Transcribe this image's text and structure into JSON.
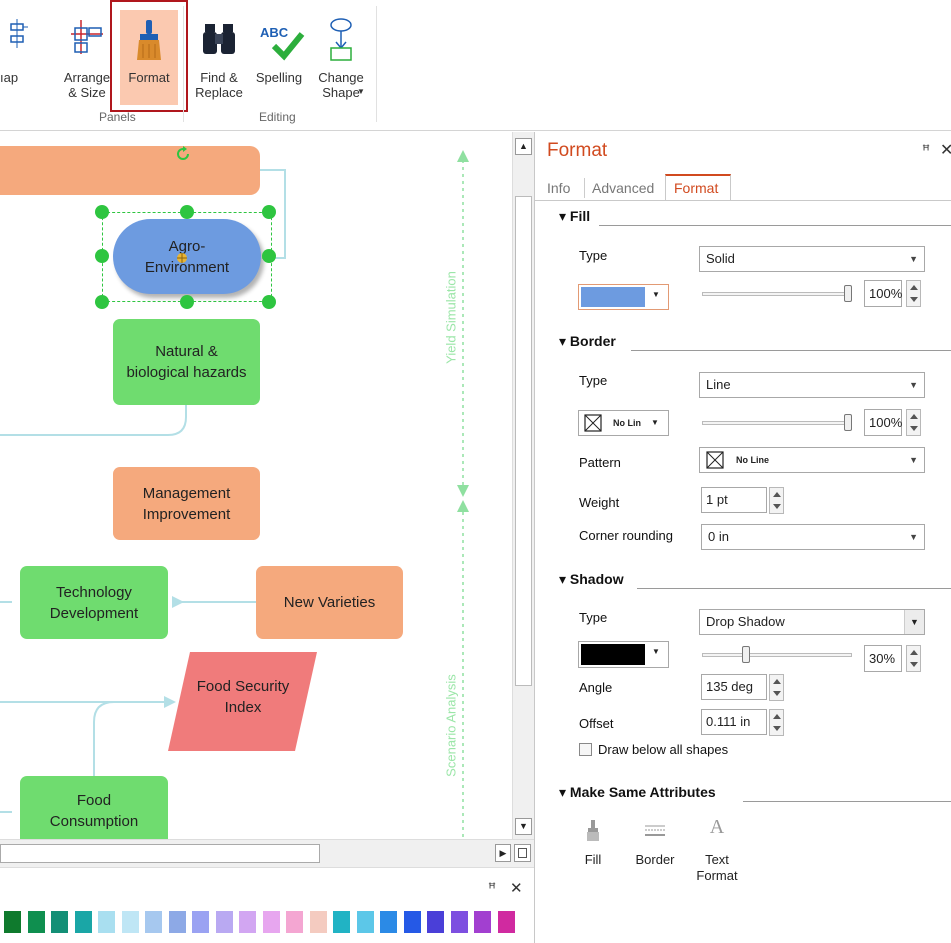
{
  "ribbon": {
    "map_label": "ıap",
    "arrange_label": "Arrange\n& Size",
    "format_label": "Format",
    "find_label": "Find &\nReplace",
    "spelling_label": "Spelling",
    "change_label": "Change\nShape",
    "abc_text": "ABC",
    "groups": {
      "panels": "Panels",
      "editing": "Editing"
    }
  },
  "diagram": {
    "nodes": {
      "agro": "Agro-\nEnvironment",
      "hazards": "Natural &\nbiological hazards",
      "management": "Management\nImprovement",
      "technology": "Technology\nDevelopment",
      "varieties": "New Varieties",
      "food_security": "Food Security\nIndex",
      "consumption": "Food\nConsumption"
    },
    "lane_labels": {
      "yield": "Yield Simulation",
      "scenario": "Scenario Analysis"
    }
  },
  "bottom_panel": {
    "pin": "ꟸ",
    "close": "✕"
  },
  "palette_colors": [
    "#0f7a2d",
    "#0f8f4f",
    "#138f76",
    "#1aa6a6",
    "#a9dff0",
    "#bfe6f5",
    "#a6c8ef",
    "#8da9e6",
    "#9aa2f2",
    "#b9a9f2",
    "#d2a6f2",
    "#e7a6ef",
    "#f4a6d2",
    "#f4cbc0",
    "#21b3c4",
    "#5cc7e8",
    "#2b8ae6",
    "#2559e6",
    "#4a3fd8",
    "#7d4fe0",
    "#a23fd0",
    "#d02aa0"
  ],
  "format_panel": {
    "title": "Format",
    "pin": "ꟸ",
    "close": "✕",
    "tabs": [
      "Info",
      "Advanced",
      "Format"
    ],
    "fill": {
      "header": "Fill",
      "type_label": "Type",
      "type_value": "Solid",
      "color": "#6d9be0",
      "opacity_value": "100%",
      "opacity_level": 1.0
    },
    "border": {
      "header": "Border",
      "type_label": "Type",
      "type_value": "Line",
      "line_swatch_label": "No Lin",
      "opacity_value": "100%",
      "opacity_level": 1.0,
      "pattern_label": "Pattern",
      "pattern_value": "No Line",
      "weight_label": "Weight",
      "weight_value": "1 pt",
      "corner_label": "Corner rounding",
      "corner_value": "0 in"
    },
    "shadow": {
      "header": "Shadow",
      "type_label": "Type",
      "type_value": "Drop Shadow",
      "color": "#000000",
      "opacity_value": "30%",
      "opacity_level": 0.3,
      "angle_label": "Angle",
      "angle_value": "135 deg",
      "offset_label": "Offset",
      "offset_value": "0.111 in",
      "draw_below_label": "Draw below all shapes",
      "draw_below_checked": false
    },
    "make_same": {
      "header": "Make Same Attributes",
      "fill_label": "Fill",
      "border_label": "Border",
      "text_label": "Text\nFormat",
      "text_glyph": "A"
    }
  }
}
